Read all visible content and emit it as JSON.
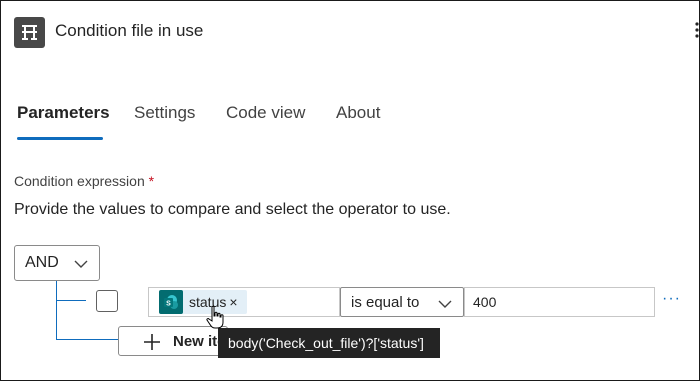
{
  "header": {
    "title": "Condition file in use",
    "icon": "condition-icon"
  },
  "tabs": [
    {
      "label": "Parameters",
      "active": true
    },
    {
      "label": "Settings",
      "active": false
    },
    {
      "label": "Code view",
      "active": false
    },
    {
      "label": "About",
      "active": false
    }
  ],
  "condition": {
    "label": "Condition expression",
    "required_mark": "*",
    "description": "Provide the values to compare and select the operator to use.",
    "group_operator": "AND",
    "row": {
      "left_token": "status",
      "token_close": "×",
      "token_icon": "sharepoint-icon",
      "operator": "is equal to",
      "right_value": "400",
      "more": "···"
    },
    "new_item_label": "New item"
  },
  "tooltip": {
    "text": "body('Check_out_file')?['status']"
  },
  "colors": {
    "accent": "#0f6cbd",
    "header_icon_bg": "#484848",
    "sharepoint": "#036c70",
    "token_bg": "#e3eff7",
    "tooltip_bg": "#242424"
  }
}
